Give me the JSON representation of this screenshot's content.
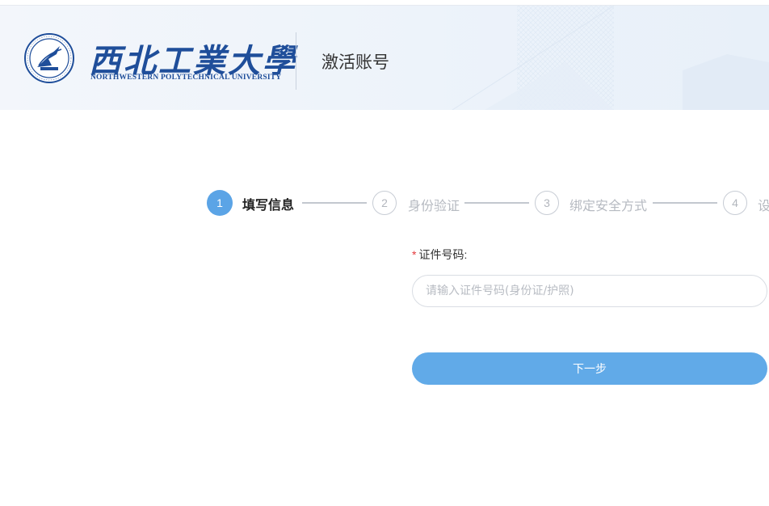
{
  "header": {
    "university_name_cn": "西北工業大學",
    "university_name_en": "NORTHWESTERN POLYTECHNICAL UNIVERSITY",
    "page_title": "激活账号",
    "emblem_icon": "university-emblem-icon"
  },
  "steps": [
    {
      "number": "1",
      "label": "填写信息",
      "state": "active"
    },
    {
      "number": "2",
      "label": "身份验证",
      "state": "todo"
    },
    {
      "number": "3",
      "label": "绑定安全方式",
      "state": "todo"
    },
    {
      "number": "4",
      "label": "设",
      "state": "todo"
    }
  ],
  "form": {
    "required_mark": "*",
    "id_label": "证件号码:",
    "id_placeholder": "请输入证件号码(身份证/护照)",
    "id_value": "",
    "next_button": "下一步"
  },
  "colors": {
    "accent": "#5ba4e6",
    "button": "#61aae8",
    "brand": "#1f4e9a",
    "required": "#e4393c"
  }
}
